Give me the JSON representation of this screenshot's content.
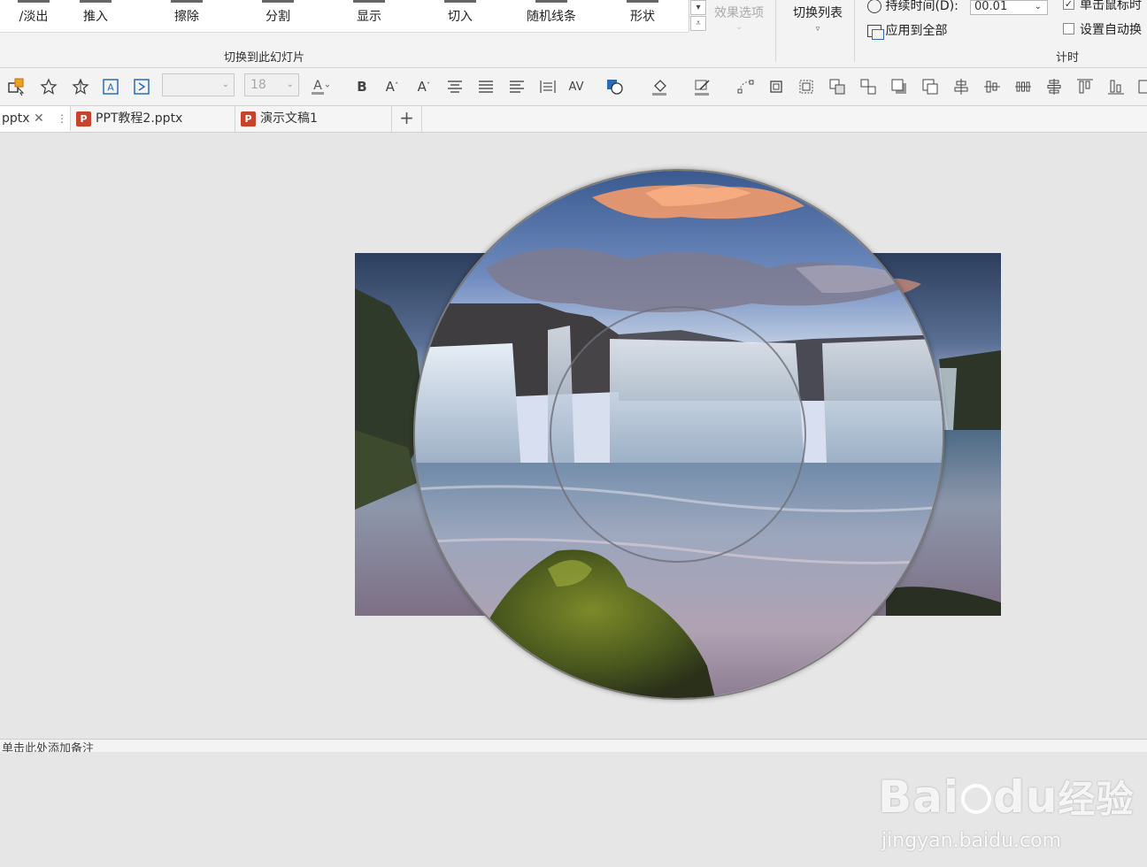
{
  "ribbon": {
    "gallery_items": [
      {
        "label": "/淡出"
      },
      {
        "label": "推入"
      },
      {
        "label": "擦除"
      },
      {
        "label": "分割"
      },
      {
        "label": "显示"
      },
      {
        "label": "切入"
      },
      {
        "label": "随机线条"
      },
      {
        "label": "形状"
      }
    ],
    "effect_options_label": "效果选项",
    "group_label": "切换到此幻灯片",
    "switch_list_label": "切换列表",
    "timing": {
      "duration_label": "持续时间(D):",
      "duration_value": "00.01",
      "apply_all_label": "应用到全部",
      "on_click_label": "单击鼠标时",
      "auto_label": "设置自动换",
      "group_label": "计时"
    }
  },
  "format_toolbar": {
    "font_name_value": "",
    "font_size_value": "18"
  },
  "tabs": [
    {
      "label": "pptx",
      "active": true
    },
    {
      "label": "PPT教程2.pptx",
      "active": false
    },
    {
      "label": "演示文稿1",
      "active": false
    }
  ],
  "tab_add_label": "+",
  "notes_placeholder": "单击此处添加备注",
  "watermark": {
    "brand": "Bai",
    "brand_suffix": "du",
    "brand_cn": "经验",
    "url": "jingyan.baidu.com"
  },
  "colors": {
    "accent": "#c8432b",
    "ribbon_bg": "#f3f3f3",
    "canvas_bg": "#e6e6e6"
  }
}
